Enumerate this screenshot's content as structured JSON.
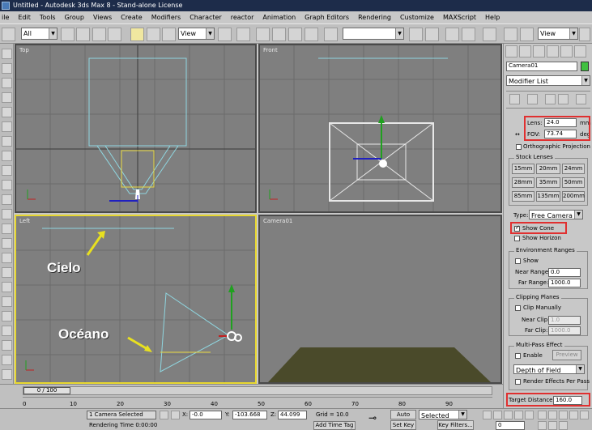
{
  "window": {
    "title": "Untitled - Autodesk 3ds Max 8 - Stand-alone License"
  },
  "menu": [
    "ile",
    "Edit",
    "Tools",
    "Group",
    "Views",
    "Create",
    "Modifiers",
    "Character",
    "reactor",
    "Animation",
    "Graph Editors",
    "Rendering",
    "Customize",
    "MAXScript",
    "Help"
  ],
  "toolbar": {
    "selection_filter": "All",
    "ref_coord": "View",
    "named_selection": "",
    "render_view": "View"
  },
  "viewports": {
    "top": "Top",
    "front": "Front",
    "left": "Left",
    "camera": "Camera01"
  },
  "annotations": {
    "sky": "Cielo",
    "ocean": "Océano"
  },
  "panel": {
    "object_name": "Camera01",
    "modifier_list": "Modifier List",
    "lens_label": "Lens:",
    "lens_value": "24.0",
    "lens_unit": "mm",
    "fov_label": "FOV:",
    "fov_value": "73.74",
    "fov_unit": "deg",
    "ortho_label": "Orthographic Projection",
    "stock_lenses_title": "Stock Lenses",
    "stock_lenses": [
      "15mm",
      "20mm",
      "24mm",
      "28mm",
      "35mm",
      "50mm",
      "85mm",
      "135mm",
      "200mm"
    ],
    "type_label": "Type:",
    "type_value": "Free Camera",
    "show_cone": "Show Cone",
    "show_horizon": "Show Horizon",
    "env_title": "Environment Ranges",
    "env_show": "Show",
    "near_range_label": "Near Range:",
    "near_range_value": "0.0",
    "far_range_label": "Far Range:",
    "far_range_value": "1000.0",
    "clip_title": "Clipping Planes",
    "clip_manually": "Clip Manually",
    "near_clip_label": "Near Clip:",
    "near_clip_value": "1.0",
    "far_clip_label": "Far Clip:",
    "far_clip_value": "1000.0",
    "multipass_title": "Multi-Pass Effect",
    "enable_label": "Enable",
    "preview_label": "Preview",
    "dof_value": "Depth of Field",
    "render_effects_label": "Render Effects Per Pass",
    "target_distance_label": "Target Distance:",
    "target_distance_value": "160.0"
  },
  "timeline": {
    "frame": "0 / 100",
    "ticks": [
      "0",
      "10",
      "20",
      "30",
      "40",
      "50",
      "60",
      "70",
      "80",
      "90"
    ]
  },
  "status": {
    "selection": "1 Camera Selected",
    "render_time": "Rendering Time  0:00:00",
    "x_label": "X:",
    "x_value": "-0.0",
    "y_label": "Y:",
    "y_value": "-103.668",
    "z_label": "Z:",
    "z_value": "44.099",
    "grid": "Grid = 10.0",
    "add_time_tag": "Add Time Tag",
    "auto_key": "Auto Key",
    "set_key": "Set Key",
    "selected": "Selected",
    "key_filters": "Key Filters...",
    "current_frame": "0"
  }
}
